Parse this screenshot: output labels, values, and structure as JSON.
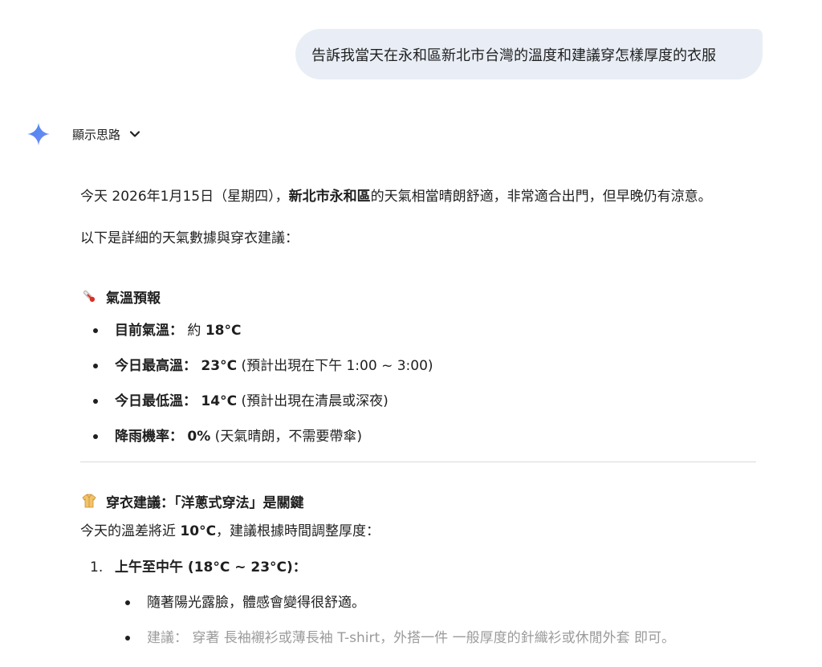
{
  "user_message": "告訴我當天在永和區新北市台灣的溫度和建議穿怎樣厚度的衣服",
  "thinking": {
    "label": "顯示思路",
    "icon": "chevron-down-icon"
  },
  "response": {
    "intro_1": "今天 2026年1月15日（星期四），",
    "intro_bold": "新北市永和區",
    "intro_2": "的天氣相當晴朗舒適，非常適合出門，但早晚仍有涼意。",
    "intro_para2": "以下是詳細的天氣數據與穿衣建議：",
    "temp_section": {
      "title": "氣溫預報",
      "icon": "thermometer-icon",
      "items": [
        {
          "label": "目前氣溫：",
          "pre": " 約 ",
          "value": "18°C",
          "note": ""
        },
        {
          "label": "今日最高溫：",
          "pre": " ",
          "value": "23°C",
          "note": " (預計出現在下午 1:00 ~ 3:00)"
        },
        {
          "label": "今日最低溫：",
          "pre": " ",
          "value": "14°C",
          "note": " (預計出現在清晨或深夜)"
        },
        {
          "label": "降雨機率：",
          "pre": " ",
          "value": "0%",
          "note": " (天氣晴朗，不需要帶傘)"
        }
      ]
    },
    "dress_section": {
      "title": "穿衣建議：「洋蔥式穿法」是關鍵",
      "icon": "coat-icon",
      "intro_1": "今天的溫差將近 ",
      "intro_bold": "10°C",
      "intro_2": "，建議根據時間調整厚度：",
      "steps": [
        {
          "num": "1.",
          "title": "上午至中午 (18°C ~ 23°C)：",
          "bullets": [
            {
              "text": "隨著陽光露臉，體感會變得很舒適。"
            },
            {
              "text": "建議： 穿著 長袖襯衫或薄長袖 T-shirt，外搭一件 一般厚度的針織衫或休閒外套 即可。"
            }
          ]
        }
      ]
    }
  },
  "colors": {
    "bubble": "#e9eef6",
    "spark_start": "#4285f4",
    "spark_end": "#9b72cb",
    "divider": "#d9d9d9"
  }
}
